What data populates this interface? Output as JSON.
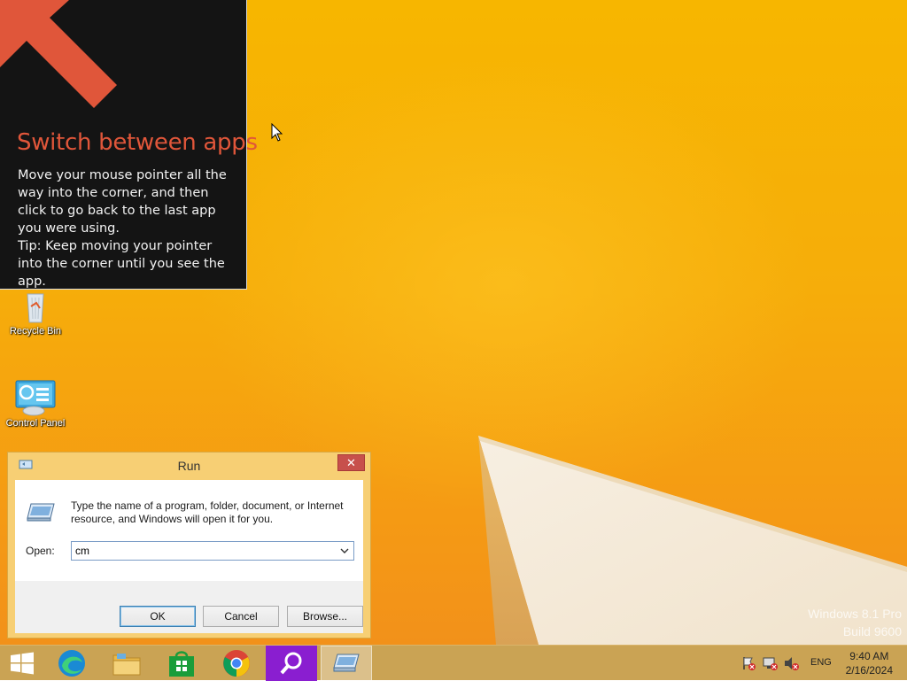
{
  "tip": {
    "title": "Switch between apps",
    "body_line1": "Move your mouse pointer all the way into the corner, and then click to go back to the last app you were using.",
    "body_line2": "Tip: Keep moving your pointer into the corner until you see the app.",
    "accent_color": "#e0563a"
  },
  "desktop_icons": [
    {
      "label": "Recycle Bin",
      "icon": "recycle-bin-icon"
    },
    {
      "label": "Control Panel",
      "icon": "control-panel-icon"
    }
  ],
  "watermark": {
    "line1": "Windows 8.1 Pro",
    "line2": "Build 9600"
  },
  "run_dialog": {
    "title": "Run",
    "close_glyph": "✕",
    "description": "Type the name of a program, folder, document, or Internet resource, and Windows will open it for you.",
    "open_label": "Open:",
    "open_value": "cm",
    "ok_label": "OK",
    "cancel_label": "Cancel",
    "browse_label": "Browse..."
  },
  "taskbar": {
    "items": [
      {
        "name": "start",
        "icon": "windows-logo-icon"
      },
      {
        "name": "edge",
        "icon": "edge-icon"
      },
      {
        "name": "file-explorer",
        "icon": "folder-icon"
      },
      {
        "name": "store",
        "icon": "store-icon"
      },
      {
        "name": "chrome",
        "icon": "chrome-icon"
      },
      {
        "name": "search-app",
        "icon": "magnifier-icon"
      },
      {
        "name": "run",
        "icon": "run-icon"
      }
    ],
    "language": "ENG",
    "time": "9:40 AM",
    "date": "2/16/2024"
  },
  "colors": {
    "wallpaper": "#f6ad0a",
    "taskbar": "#caa354",
    "dialog_frame": "#f7cf74",
    "close_button": "#c7504c"
  }
}
